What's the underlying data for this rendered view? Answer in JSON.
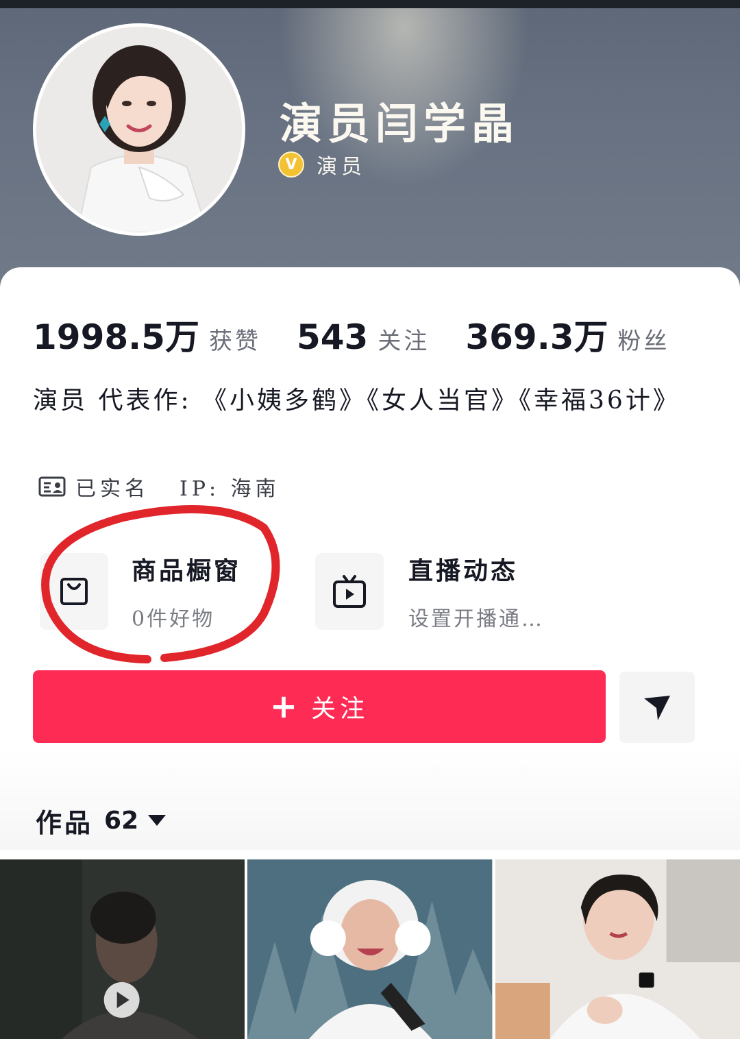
{
  "profile": {
    "name": "演员闫学晶",
    "verified_label": "演员",
    "verified_icon": "v-badge-icon"
  },
  "stats": [
    {
      "value": "1998.5万",
      "label": "获赞"
    },
    {
      "value": "543",
      "label": "关注"
    },
    {
      "value": "369.3万",
      "label": "粉丝"
    }
  ],
  "bio": "演员 代表作: 《小姨多鹤》《女人当官》《幸福36计》",
  "meta": {
    "id_label": "已实名",
    "ip_label": "IP: 海南"
  },
  "entries": {
    "shop": {
      "title": "商品橱窗",
      "subtitle": "0件好物",
      "icon": "shopping-bag-icon"
    },
    "live": {
      "title": "直播动态",
      "subtitle": "设置开播通…",
      "icon": "tv-icon"
    }
  },
  "actions": {
    "follow_label": "关注",
    "share_icon": "send-icon"
  },
  "works": {
    "label": "作品",
    "count": "62"
  },
  "colors": {
    "accent": "#fe2c55",
    "annotation_circle": "#e0252b",
    "verify_badge": "#f3c233"
  }
}
